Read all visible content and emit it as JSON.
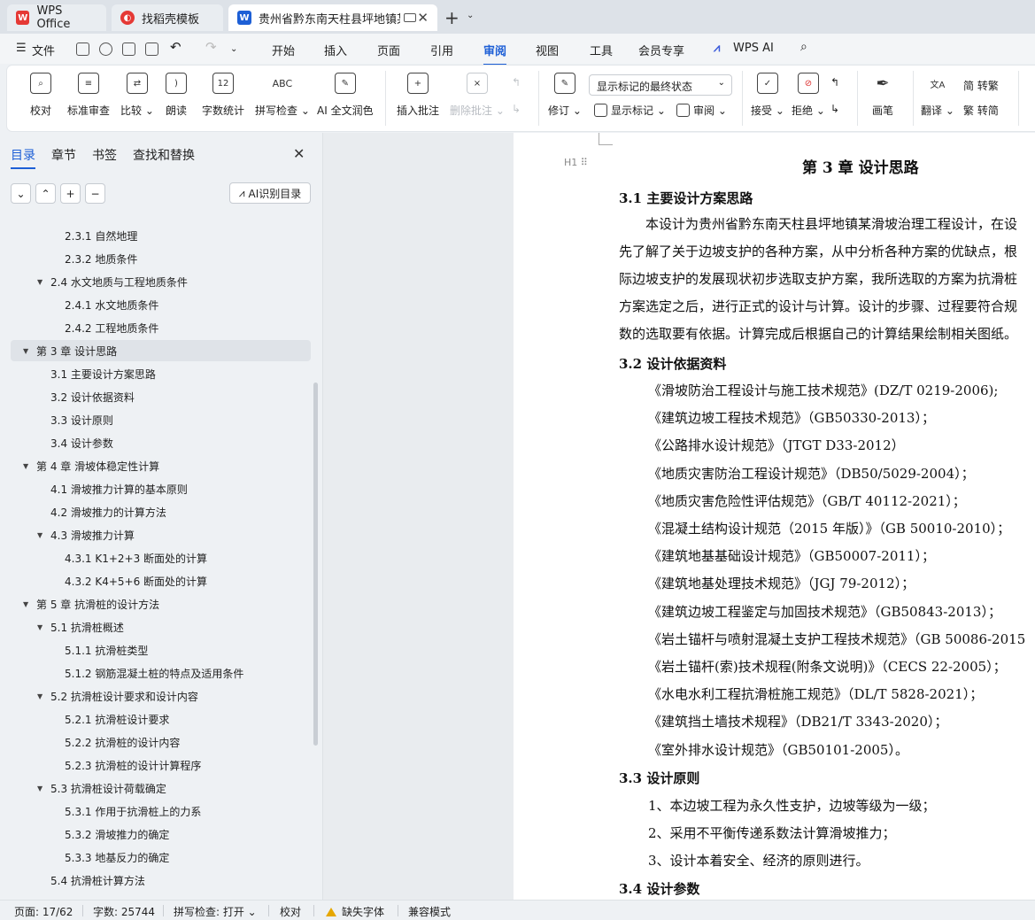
{
  "tabs": [
    {
      "label": "WPS Office",
      "icon": "wps-logo-icon",
      "color": "#e53935"
    },
    {
      "label": "找稻壳模板",
      "icon": "docer-logo-icon",
      "color": "#e53935"
    },
    {
      "label": "贵州省黔东南天柱县坪地镇某",
      "icon": "word-doc-icon",
      "color": "#1d5fd6"
    }
  ],
  "menu": {
    "file": "文件",
    "items": [
      "开始",
      "插入",
      "页面",
      "引用",
      "审阅",
      "视图",
      "工具",
      "会员专享",
      "WPS AI"
    ],
    "active": "审阅"
  },
  "ribbon": {
    "proofread": "校对",
    "standard_review": "标准审查",
    "compare": "比较",
    "read_aloud": "朗读",
    "word_count": "字数统计",
    "spell_check": "拼写检查",
    "ai_polish": "AI 全文润色",
    "insert_comment": "插入批注",
    "delete_comment": "删除批注",
    "revise": "修订",
    "markup_select": "显示标记的最终状态",
    "show_markup": "显示标记",
    "review": "审阅",
    "accept": "接受",
    "reject": "拒绝",
    "pen": "画笔",
    "translate": "翻译",
    "to_traditional": "转繁",
    "to_simplified": "转简",
    "word_count_icon_text": "12",
    "spell_icon_text": "ABC"
  },
  "nav": {
    "tabs": [
      "目录",
      "章节",
      "书签",
      "查找和替换"
    ],
    "ai_button": "AI识别目录",
    "toc": [
      {
        "label": "2.3.1 自然地理",
        "level": 3,
        "tri": false
      },
      {
        "label": "2.3.2 地质条件",
        "level": 3,
        "tri": false
      },
      {
        "label": "2.4 水文地质与工程地质条件",
        "level": 2,
        "tri": true
      },
      {
        "label": "2.4.1 水文地质条件",
        "level": 3,
        "tri": false
      },
      {
        "label": "2.4.2 工程地质条件",
        "level": 3,
        "tri": false
      },
      {
        "label": "第 3 章  设计思路",
        "level": 1,
        "tri": true,
        "selected": true
      },
      {
        "label": "3.1  主要设计方案思路",
        "level": 2,
        "tri": false
      },
      {
        "label": "3.2  设计依据资料",
        "level": 2,
        "tri": false
      },
      {
        "label": "3.3 设计原则",
        "level": 2,
        "tri": false
      },
      {
        "label": "3.4 设计参数",
        "level": 2,
        "tri": false
      },
      {
        "label": "第 4 章  滑坡体稳定性计算",
        "level": 1,
        "tri": true
      },
      {
        "label": "4.1  滑坡推力计算的基本原则",
        "level": 2,
        "tri": false
      },
      {
        "label": "4.2  滑坡推力的计算方法",
        "level": 2,
        "tri": false
      },
      {
        "label": "4.3  滑坡推力计算",
        "level": 2,
        "tri": true
      },
      {
        "label": "4.3.1 K1+2+3 断面处的计算",
        "level": 3,
        "tri": false
      },
      {
        "label": "4.3.2 K4+5+6 断面处的计算",
        "level": 3,
        "tri": false
      },
      {
        "label": "第 5 章  抗滑桩的设计方法",
        "level": 1,
        "tri": true
      },
      {
        "label": "5.1  抗滑桩概述",
        "level": 2,
        "tri": true
      },
      {
        "label": "5.1.1  抗滑桩类型",
        "level": 3,
        "tri": false
      },
      {
        "label": "5.1.2  钢筋混凝土桩的特点及适用条件",
        "level": 3,
        "tri": false
      },
      {
        "label": "5.2  抗滑桩设计要求和设计内容",
        "level": 2,
        "tri": true
      },
      {
        "label": "5.2.1  抗滑桩设计要求",
        "level": 3,
        "tri": false
      },
      {
        "label": "5.2.2  抗滑桩的设计内容",
        "level": 3,
        "tri": false
      },
      {
        "label": "5.2.3  抗滑桩的设计计算程序",
        "level": 3,
        "tri": false
      },
      {
        "label": "5.3  抗滑桩设计荷载确定",
        "level": 2,
        "tri": true
      },
      {
        "label": "5.3.1  作用于抗滑桩上的力系",
        "level": 3,
        "tri": false
      },
      {
        "label": "5.3.2  滑坡推力的确定",
        "level": 3,
        "tri": false
      },
      {
        "label": "5.3.3  地基反力的确定",
        "level": 3,
        "tri": false
      },
      {
        "label": "5.4  抗滑桩计算方法",
        "level": 2,
        "tri": false
      }
    ]
  },
  "doc": {
    "chapter_title": "第 3 章  设计思路",
    "heading_mark": "H1",
    "s31": "3.1  主要设计方案思路",
    "s31_para": [
      "　　本设计为贵州省黔东南天柱县坪地镇某滑坡治理工程设计，在设",
      "先了解了关于边坡支护的各种方案，从中分析各种方案的优缺点，根",
      "际边坡支护的发展现状初步选取支护方案，我所选取的方案为抗滑桩",
      "方案选定之后，进行正式的设计与计算。设计的步骤、过程要符合规",
      "数的选取要有依据。计算完成后根据自己的计算结果绘制相关图纸。"
    ],
    "s32": "3.2  设计依据资料",
    "refs": [
      "《滑坡防治工程设计与施工技术规范》(DZ/T 0219-2006);",
      "《建筑边坡工程技术规范》（GB50330-2013）；",
      "《公路排水设计规范》（JTGT D33-2012）",
      "《地质灾害防治工程设计规范》（DB50/5029-2004）；",
      "《地质灾害危险性评估规范》（GB/T 40112-2021）；",
      "《混凝土结构设计规范（2015 年版）》（GB 50010-2010）；",
      "《建筑地基基础设计规范》（GB50007-2011）；",
      "《建筑地基处理技术规范》（JGJ 79-2012）；",
      "《建筑边坡工程鉴定与加固技术规范》（GB50843-2013）；",
      "《岩土锚杆与喷射混凝土支护工程技术规范》（GB 50086-2015",
      "《岩土锚杆(索)技术规程(附条文说明)》（CECS 22-2005）；",
      "《水电水利工程抗滑桩施工规范》（DL/T 5828-2021）；",
      "《建筑挡土墙技术规程》（DB21/T 3343-2020）；",
      "《室外排水设计规范》（GB50101-2005）。"
    ],
    "s33": "3.3 设计原则",
    "principles": [
      "1、本边坡工程为永久性支护，边坡等级为一级；",
      "2、采用不平衡传递系数法计算滑坡推力；",
      "3、设计本着安全、经济的原则进行。"
    ],
    "s34": "3.4 设计参数"
  },
  "status": {
    "page": "页面: 17/62",
    "words": "字数: 25744",
    "spell": "拼写检查: 打开",
    "proof": "校对",
    "missing_font": "缺失字体",
    "compat": "兼容模式"
  }
}
